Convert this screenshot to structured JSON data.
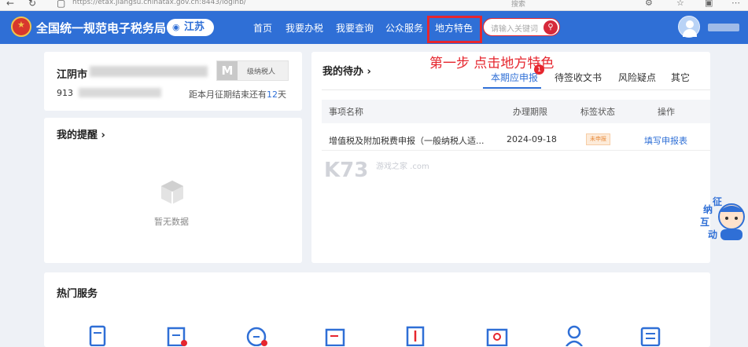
{
  "browser": {
    "url": "https://etax.jiangsu.chinatax.gov.cn:8443/loginb/",
    "find_placeholder": "搜索"
  },
  "header": {
    "site_title": "全国统一规范电子税务局",
    "region": "江苏",
    "nav": [
      "首页",
      "我要办税",
      "我要查询",
      "公众服务",
      "地方特色"
    ],
    "search_placeholder": "请输入关键词"
  },
  "company": {
    "name_prefix": "江阴市",
    "taxid_prefix": "913",
    "level_letter": "M",
    "level_label": "级纳税人",
    "deadline_prefix": "距本月征期结束还有",
    "deadline_days": "12",
    "deadline_suffix": "天"
  },
  "reminder": {
    "title": "我的提醒",
    "empty_text": "暂无数据"
  },
  "todo": {
    "title": "我的待办",
    "annotation": "第一步 点击地方特色",
    "tabs": [
      "本期应申报",
      "待签收文书",
      "风险疑点",
      "其它"
    ],
    "tab_badge": "1",
    "columns": [
      "事项名称",
      "办理期限",
      "标签状态",
      "操作"
    ],
    "rows": [
      {
        "name": "增值税及附加税费申报（一般纳税人适...",
        "deadline": "2024-09-18",
        "status": "未申报",
        "action": "填写申报表"
      }
    ],
    "watermark": "K73",
    "watermark_sub": "游戏之家 .com"
  },
  "hot": {
    "title": "热门服务"
  },
  "float_widget": {
    "chars": [
      "征",
      "纳",
      "互",
      "动"
    ]
  },
  "colors": {
    "header_blue": "#2f6fd6",
    "highlight_red": "#e6262e",
    "status_orange": "#e88a3a"
  }
}
